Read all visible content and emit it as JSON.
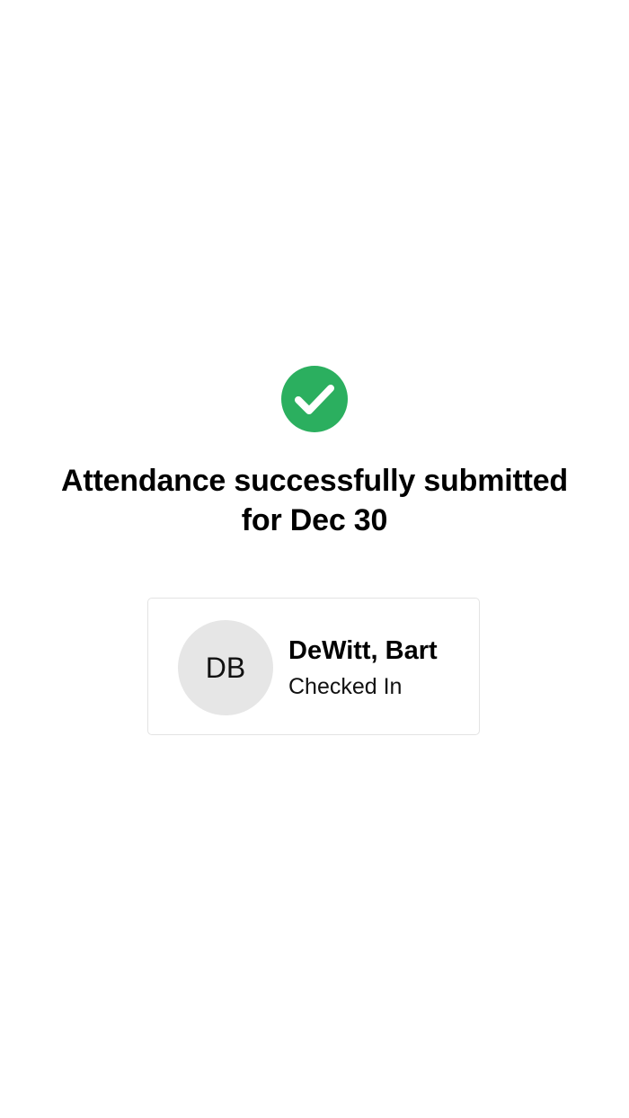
{
  "confirmation": {
    "icon": "check-circle-icon",
    "icon_color": "#2BAF5F",
    "title_line1": "Attendance successfully submitted",
    "title_line2": "for Dec 30"
  },
  "attendee": {
    "initials": "DB",
    "name": "DeWitt, Bart",
    "status": "Checked In"
  }
}
